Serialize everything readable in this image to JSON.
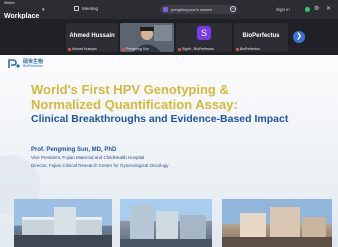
{
  "topbar": {
    "brand_small": "Webex",
    "brand": "Workplace",
    "meeting_label": "Meeting",
    "share_label": "pengming.sun's screen",
    "signin_label": "Sign in"
  },
  "participants": [
    {
      "name": "Ahmed Hussain",
      "tag": "Ahmed Hussain"
    },
    {
      "name": "",
      "tag": "Pengming Sun"
    },
    {
      "name": "S",
      "tag": "Signit - BioPerfectus"
    },
    {
      "name": "BioPerfectus",
      "tag": "BioPerfectus"
    }
  ],
  "slide": {
    "logo_cn": "硕世生物",
    "logo_en": "BioPerfectus",
    "title_line1": "World's First HPV Genotyping &",
    "title_line2": "Normalized Quantification Assay:",
    "subtitle": "Clinical Breakthroughs and Evidence-Based Impact",
    "speaker_name": "Prof. Pengming Sun, MD, PhD",
    "speaker_role1": "Vice President, Fujian Maternal and ChildHealth Hospital",
    "speaker_role2": "Director, Fujian Clinical Research Center for Gynecological Oncology"
  },
  "colors": {
    "title_gold": "#d7b93a",
    "subtitle_blue": "#1e56a8",
    "avatar_purple": "#7c3aed",
    "accent_blue": "#3b74d6"
  }
}
